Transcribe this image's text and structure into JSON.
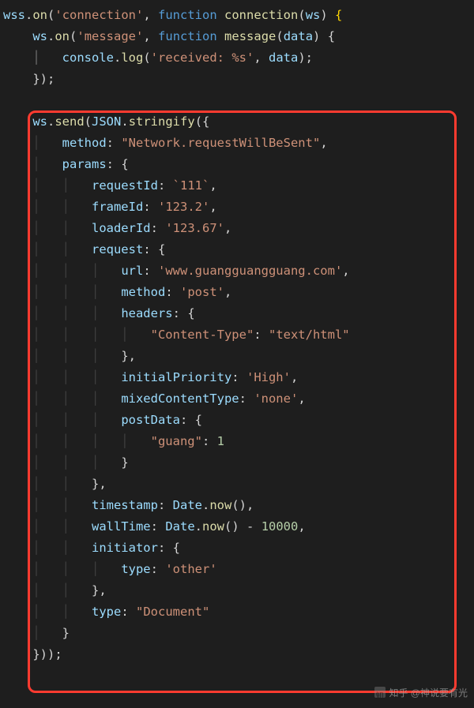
{
  "watermark": "知乎 @神说要有光",
  "code": {
    "tokens": [
      [
        [
          "obj",
          "wss"
        ],
        [
          "pun",
          "."
        ],
        [
          "fn",
          "on"
        ],
        [
          "pun",
          "("
        ],
        [
          "str",
          "'connection'"
        ],
        [
          "pun",
          ", "
        ],
        [
          "kw",
          "function"
        ],
        [
          "pun",
          " "
        ],
        [
          "fn",
          "connection"
        ],
        [
          "pun",
          "("
        ],
        [
          "obj",
          "ws"
        ],
        [
          "pun",
          ") "
        ],
        [
          "brace",
          "{"
        ]
      ],
      [
        [
          "pun",
          "    "
        ],
        [
          "obj",
          "ws"
        ],
        [
          "pun",
          "."
        ],
        [
          "fn",
          "on"
        ],
        [
          "pun",
          "("
        ],
        [
          "str",
          "'message'"
        ],
        [
          "pun",
          ", "
        ],
        [
          "kw",
          "function"
        ],
        [
          "pun",
          " "
        ],
        [
          "fn",
          "message"
        ],
        [
          "pun",
          "("
        ],
        [
          "obj",
          "data"
        ],
        [
          "pun",
          ") {"
        ]
      ],
      [
        [
          "guide",
          "    "
        ],
        [
          "guidea",
          "│   "
        ],
        [
          "obj",
          "console"
        ],
        [
          "pun",
          "."
        ],
        [
          "fn",
          "log"
        ],
        [
          "pun",
          "("
        ],
        [
          "str",
          "'received: %s'"
        ],
        [
          "pun",
          ", "
        ],
        [
          "obj",
          "data"
        ],
        [
          "pun",
          ");"
        ]
      ],
      [
        [
          "pun",
          "    });"
        ]
      ],
      [
        [
          "pun",
          " "
        ]
      ],
      [
        [
          "pun",
          "    "
        ],
        [
          "obj",
          "ws"
        ],
        [
          "pun",
          "."
        ],
        [
          "fn",
          "send"
        ],
        [
          "pun",
          "("
        ],
        [
          "obj",
          "JSON"
        ],
        [
          "pun",
          "."
        ],
        [
          "fn",
          "stringify"
        ],
        [
          "pun",
          "({"
        ]
      ],
      [
        [
          "guide",
          "    │   "
        ],
        [
          "obj",
          "method"
        ],
        [
          "pun",
          ":"
        ],
        [
          "pun",
          " "
        ],
        [
          "str",
          "\"Network.requestWillBeSent\""
        ],
        [
          "pun",
          ","
        ]
      ],
      [
        [
          "guide",
          "    │   "
        ],
        [
          "obj",
          "params"
        ],
        [
          "pun",
          ":"
        ],
        [
          "pun",
          " {"
        ]
      ],
      [
        [
          "guide",
          "    │   │   "
        ],
        [
          "obj",
          "requestId"
        ],
        [
          "pun",
          ":"
        ],
        [
          "pun",
          " "
        ],
        [
          "str",
          "`111`"
        ],
        [
          "pun",
          ","
        ]
      ],
      [
        [
          "guide",
          "    │   │   "
        ],
        [
          "obj",
          "frameId"
        ],
        [
          "pun",
          ":"
        ],
        [
          "pun",
          " "
        ],
        [
          "str",
          "'123.2'"
        ],
        [
          "pun",
          ","
        ]
      ],
      [
        [
          "guide",
          "    │   │   "
        ],
        [
          "obj",
          "loaderId"
        ],
        [
          "pun",
          ":"
        ],
        [
          "pun",
          " "
        ],
        [
          "str",
          "'123.67'"
        ],
        [
          "pun",
          ","
        ]
      ],
      [
        [
          "guide",
          "    │   │   "
        ],
        [
          "obj",
          "request"
        ],
        [
          "pun",
          ":"
        ],
        [
          "pun",
          " {"
        ]
      ],
      [
        [
          "guide",
          "    │   │   │   "
        ],
        [
          "obj",
          "url"
        ],
        [
          "pun",
          ":"
        ],
        [
          "pun",
          " "
        ],
        [
          "str",
          "'www.guangguangguang.com'"
        ],
        [
          "pun",
          ","
        ]
      ],
      [
        [
          "guide",
          "    │   │   │   "
        ],
        [
          "obj",
          "method"
        ],
        [
          "pun",
          ":"
        ],
        [
          "pun",
          " "
        ],
        [
          "str",
          "'post'"
        ],
        [
          "pun",
          ","
        ]
      ],
      [
        [
          "guide",
          "    │   │   │   "
        ],
        [
          "obj",
          "headers"
        ],
        [
          "pun",
          ":"
        ],
        [
          "pun",
          " {"
        ]
      ],
      [
        [
          "guide",
          "    │   │   │   │   "
        ],
        [
          "str",
          "\"Content-Type\""
        ],
        [
          "pun",
          ":"
        ],
        [
          "pun",
          " "
        ],
        [
          "str",
          "\"text/html\""
        ]
      ],
      [
        [
          "guide",
          "    │   │   │   "
        ],
        [
          "pun",
          "},"
        ]
      ],
      [
        [
          "guide",
          "    │   │   │   "
        ],
        [
          "obj",
          "initialPriority"
        ],
        [
          "pun",
          ":"
        ],
        [
          "pun",
          " "
        ],
        [
          "str",
          "'High'"
        ],
        [
          "pun",
          ","
        ]
      ],
      [
        [
          "guide",
          "    │   │   │   "
        ],
        [
          "obj",
          "mixedContentType"
        ],
        [
          "pun",
          ":"
        ],
        [
          "pun",
          " "
        ],
        [
          "str",
          "'none'"
        ],
        [
          "pun",
          ","
        ]
      ],
      [
        [
          "guide",
          "    │   │   │   "
        ],
        [
          "obj",
          "postData"
        ],
        [
          "pun",
          ":"
        ],
        [
          "pun",
          " {"
        ]
      ],
      [
        [
          "guide",
          "    │   │   │   │   "
        ],
        [
          "str",
          "\"guang\""
        ],
        [
          "pun",
          ":"
        ],
        [
          "pun",
          " "
        ],
        [
          "num",
          "1"
        ]
      ],
      [
        [
          "guide",
          "    │   │   │   "
        ],
        [
          "pun",
          "}"
        ]
      ],
      [
        [
          "guide",
          "    │   │   "
        ],
        [
          "pun",
          "},"
        ]
      ],
      [
        [
          "guide",
          "    │   │   "
        ],
        [
          "obj",
          "timestamp"
        ],
        [
          "pun",
          ":"
        ],
        [
          "pun",
          " "
        ],
        [
          "obj",
          "Date"
        ],
        [
          "pun",
          "."
        ],
        [
          "fn",
          "now"
        ],
        [
          "pun",
          "(),"
        ]
      ],
      [
        [
          "guide",
          "    │   │   "
        ],
        [
          "obj",
          "wallTime"
        ],
        [
          "pun",
          ":"
        ],
        [
          "pun",
          " "
        ],
        [
          "obj",
          "Date"
        ],
        [
          "pun",
          "."
        ],
        [
          "fn",
          "now"
        ],
        [
          "pun",
          "() "
        ],
        [
          "pun",
          "-"
        ],
        [
          "pun",
          " "
        ],
        [
          "num",
          "10000"
        ],
        [
          "pun",
          ","
        ]
      ],
      [
        [
          "guide",
          "    │   │   "
        ],
        [
          "obj",
          "initiator"
        ],
        [
          "pun",
          ":"
        ],
        [
          "pun",
          " {"
        ]
      ],
      [
        [
          "guide",
          "    │   │   │   "
        ],
        [
          "obj",
          "type"
        ],
        [
          "pun",
          ":"
        ],
        [
          "pun",
          " "
        ],
        [
          "str",
          "'other'"
        ]
      ],
      [
        [
          "guide",
          "    │   │   "
        ],
        [
          "pun",
          "},"
        ]
      ],
      [
        [
          "guide",
          "    │   │   "
        ],
        [
          "obj",
          "type"
        ],
        [
          "pun",
          ":"
        ],
        [
          "pun",
          " "
        ],
        [
          "str",
          "\"Document\""
        ]
      ],
      [
        [
          "guide",
          "    │   "
        ],
        [
          "pun",
          "}"
        ]
      ],
      [
        [
          "pun",
          "    }));"
        ]
      ]
    ],
    "structured": {
      "wss.on": "connection",
      "ws.on": "message",
      "console.log": "received: %s",
      "ws.send.payload": {
        "method": "Network.requestWillBeSent",
        "params": {
          "requestId": "111",
          "frameId": "123.2",
          "loaderId": "123.67",
          "request": {
            "url": "www.guangguangguang.com",
            "method": "post",
            "headers": {
              "Content-Type": "text/html"
            },
            "initialPriority": "High",
            "mixedContentType": "none",
            "postData": {
              "guang": 1
            }
          },
          "timestamp": "Date.now()",
          "wallTime": "Date.now() - 10000",
          "initiator": {
            "type": "other"
          },
          "type": "Document"
        }
      }
    }
  }
}
